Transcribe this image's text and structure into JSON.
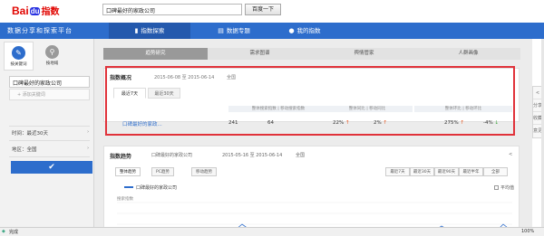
{
  "header": {
    "logo_text": "Bai",
    "logo_du": "du",
    "logo_suffix": "指数",
    "search_value": "口碑最好的家政公司",
    "search_button": "百度一下"
  },
  "nav": {
    "brand": "数据分享和探索平台",
    "tabs": [
      {
        "label": "指数探索",
        "icon": "bar-chart-icon"
      },
      {
        "label": "数据专题",
        "icon": "document-icon"
      },
      {
        "label": "我的指数",
        "icon": "user-icon"
      }
    ]
  },
  "sidebar": {
    "mode_keyword": "按关键词",
    "mode_region": "按地域",
    "keyword": "口碑最好的家政公司",
    "add_placeholder": "+ 添加关键词",
    "time_label": "时间：最近30天",
    "region_label": "地区：全国",
    "confirm_icon": "✔"
  },
  "subtabs": [
    "趋势研究",
    "需求图谱",
    "舆情管家",
    "人群画像"
  ],
  "overview": {
    "title": "指数概况",
    "date_range": "2015-06-08 至 2015-06-14",
    "region": "全国",
    "tabs": [
      "最近7天",
      "最近30天"
    ],
    "headers": {
      "index": "整体搜索指数  |  移动搜索指数",
      "yoy": "整体同比  |  移动同比",
      "mom": "整体环比  |  移动环比"
    },
    "row": {
      "keyword": "口碑最好的家政...",
      "total_index": "241",
      "mobile_index": "64",
      "total_yoy": "22%",
      "total_yoy_arrow": "↑",
      "mobile_yoy": "2%",
      "mobile_yoy_arrow": "↑",
      "total_mom": "275%",
      "total_mom_arrow": "↑",
      "mobile_mom": "-4%",
      "mobile_mom_arrow": "↓"
    }
  },
  "trend": {
    "title": "指数趋势",
    "keyword_chip": "口碑最好的家政公司",
    "date_range": "2015-05-16 至 2015-06-14",
    "region": "全国",
    "tabs": [
      "整体趋势",
      "PC趋势",
      "移动趋势"
    ],
    "ranges": [
      "最近7天",
      "最近30天",
      "最近90天",
      "最近半年",
      "全部"
    ],
    "legend": "口碑最好的家政公司",
    "average_toggle": "平均值",
    "y_label": "搜索指数"
  },
  "right_toolbar": [
    "<",
    "分享",
    "收藏",
    "意见"
  ],
  "status": {
    "text": "完成",
    "zoom": "100%"
  },
  "colors": {
    "brand_blue": "#2d6dcc",
    "highlight_red": "#e0323a",
    "up": "#e8541e",
    "down": "#3aa33a"
  }
}
